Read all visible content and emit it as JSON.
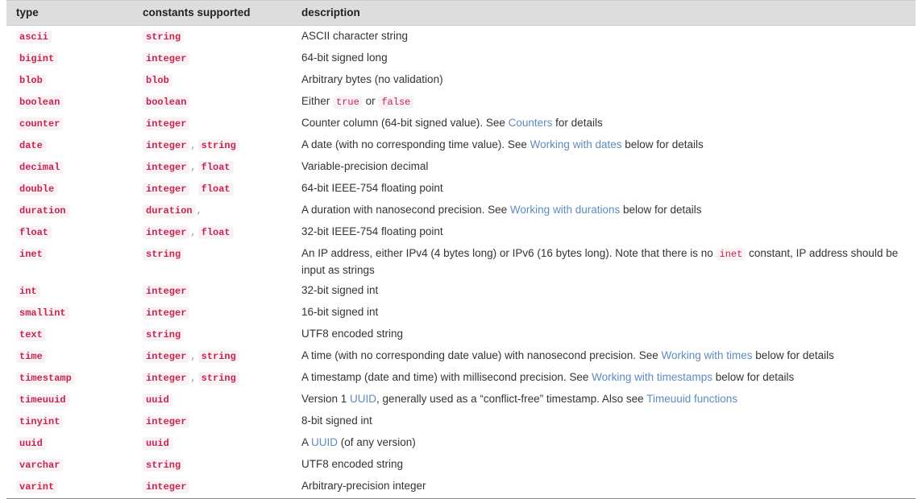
{
  "table": {
    "headers": {
      "type": "type",
      "constants": "constants supported",
      "description": "description"
    },
    "colors": {
      "header_background": "#dddddd",
      "code_text": "#c7254e",
      "code_background": "#f9f2f4",
      "link": "#5c8bbf",
      "body_text": "#333333",
      "bottom_border": "#888888"
    },
    "rows": [
      {
        "type": "ascii",
        "constants": [
          "string"
        ],
        "trailing_comma": false,
        "description_parts": [
          {
            "kind": "text",
            "value": "ASCII character string"
          }
        ]
      },
      {
        "type": "bigint",
        "constants": [
          "integer"
        ],
        "trailing_comma": false,
        "description_parts": [
          {
            "kind": "text",
            "value": "64-bit signed long"
          }
        ]
      },
      {
        "type": "blob",
        "constants": [
          "blob"
        ],
        "trailing_comma": false,
        "description_parts": [
          {
            "kind": "text",
            "value": "Arbitrary bytes (no validation)"
          }
        ]
      },
      {
        "type": "boolean",
        "constants": [
          "boolean"
        ],
        "trailing_comma": false,
        "description_parts": [
          {
            "kind": "text",
            "value": "Either "
          },
          {
            "kind": "code",
            "value": "true"
          },
          {
            "kind": "text",
            "value": " or "
          },
          {
            "kind": "code",
            "value": "false"
          }
        ]
      },
      {
        "type": "counter",
        "constants": [
          "integer"
        ],
        "trailing_comma": false,
        "description_parts": [
          {
            "kind": "text",
            "value": "Counter column (64-bit signed value). See "
          },
          {
            "kind": "link",
            "value": "Counters"
          },
          {
            "kind": "text",
            "value": " for details"
          }
        ]
      },
      {
        "type": "date",
        "constants": [
          "integer",
          "string"
        ],
        "trailing_comma": false,
        "description_parts": [
          {
            "kind": "text",
            "value": "A date (with no corresponding time value). See "
          },
          {
            "kind": "link",
            "value": "Working with dates"
          },
          {
            "kind": "text",
            "value": " below for details"
          }
        ]
      },
      {
        "type": "decimal",
        "constants": [
          "integer",
          "float"
        ],
        "trailing_comma": false,
        "description_parts": [
          {
            "kind": "text",
            "value": "Variable-precision decimal"
          }
        ]
      },
      {
        "type": "double",
        "constants": [
          "integer",
          "float"
        ],
        "no_separator": true,
        "trailing_comma": false,
        "description_parts": [
          {
            "kind": "text",
            "value": "64-bit IEEE-754 floating point"
          }
        ]
      },
      {
        "type": "duration",
        "constants": [
          "duration"
        ],
        "trailing_comma": true,
        "description_parts": [
          {
            "kind": "text",
            "value": "A duration with nanosecond precision. See "
          },
          {
            "kind": "link",
            "value": "Working with durations"
          },
          {
            "kind": "text",
            "value": " below for details"
          }
        ]
      },
      {
        "type": "float",
        "constants": [
          "integer",
          "float"
        ],
        "trailing_comma": false,
        "description_parts": [
          {
            "kind": "text",
            "value": "32-bit IEEE-754 floating point"
          }
        ]
      },
      {
        "type": "inet",
        "constants": [
          "string"
        ],
        "trailing_comma": false,
        "description_parts": [
          {
            "kind": "text",
            "value": "An IP address, either IPv4 (4 bytes long) or IPv6 (16 bytes long). Note that there is no "
          },
          {
            "kind": "code",
            "value": "inet"
          },
          {
            "kind": "text",
            "value": " constant, IP address should be input as strings"
          }
        ]
      },
      {
        "type": "int",
        "constants": [
          "integer"
        ],
        "trailing_comma": false,
        "description_parts": [
          {
            "kind": "text",
            "value": "32-bit signed int"
          }
        ]
      },
      {
        "type": "smallint",
        "constants": [
          "integer"
        ],
        "trailing_comma": false,
        "description_parts": [
          {
            "kind": "text",
            "value": "16-bit signed int"
          }
        ]
      },
      {
        "type": "text",
        "constants": [
          "string"
        ],
        "trailing_comma": false,
        "description_parts": [
          {
            "kind": "text",
            "value": "UTF8 encoded string"
          }
        ]
      },
      {
        "type": "time",
        "constants": [
          "integer",
          "string"
        ],
        "trailing_comma": false,
        "description_parts": [
          {
            "kind": "text",
            "value": "A time (with no corresponding date value) with nanosecond precision. See "
          },
          {
            "kind": "link",
            "value": "Working with times"
          },
          {
            "kind": "text",
            "value": " below for details"
          }
        ]
      },
      {
        "type": "timestamp",
        "constants": [
          "integer",
          "string"
        ],
        "trailing_comma": false,
        "description_parts": [
          {
            "kind": "text",
            "value": "A timestamp (date and time) with millisecond precision. See "
          },
          {
            "kind": "link",
            "value": "Working with timestamps"
          },
          {
            "kind": "text",
            "value": " below for details"
          }
        ]
      },
      {
        "type": "timeuuid",
        "constants": [
          "uuid"
        ],
        "trailing_comma": false,
        "description_parts": [
          {
            "kind": "text",
            "value": "Version 1 "
          },
          {
            "kind": "link",
            "value": "UUID"
          },
          {
            "kind": "text",
            "value": ", generally used as a “conflict-free” timestamp. Also see "
          },
          {
            "kind": "link",
            "value": "Timeuuid functions"
          }
        ]
      },
      {
        "type": "tinyint",
        "constants": [
          "integer"
        ],
        "trailing_comma": false,
        "description_parts": [
          {
            "kind": "text",
            "value": "8-bit signed int"
          }
        ]
      },
      {
        "type": "uuid",
        "constants": [
          "uuid"
        ],
        "trailing_comma": false,
        "description_parts": [
          {
            "kind": "text",
            "value": "A "
          },
          {
            "kind": "link",
            "value": "UUID"
          },
          {
            "kind": "text",
            "value": " (of any version)"
          }
        ]
      },
      {
        "type": "varchar",
        "constants": [
          "string"
        ],
        "trailing_comma": false,
        "description_parts": [
          {
            "kind": "text",
            "value": "UTF8 encoded string"
          }
        ]
      },
      {
        "type": "varint",
        "constants": [
          "integer"
        ],
        "trailing_comma": false,
        "description_parts": [
          {
            "kind": "text",
            "value": "Arbitrary-precision integer"
          }
        ]
      }
    ]
  }
}
